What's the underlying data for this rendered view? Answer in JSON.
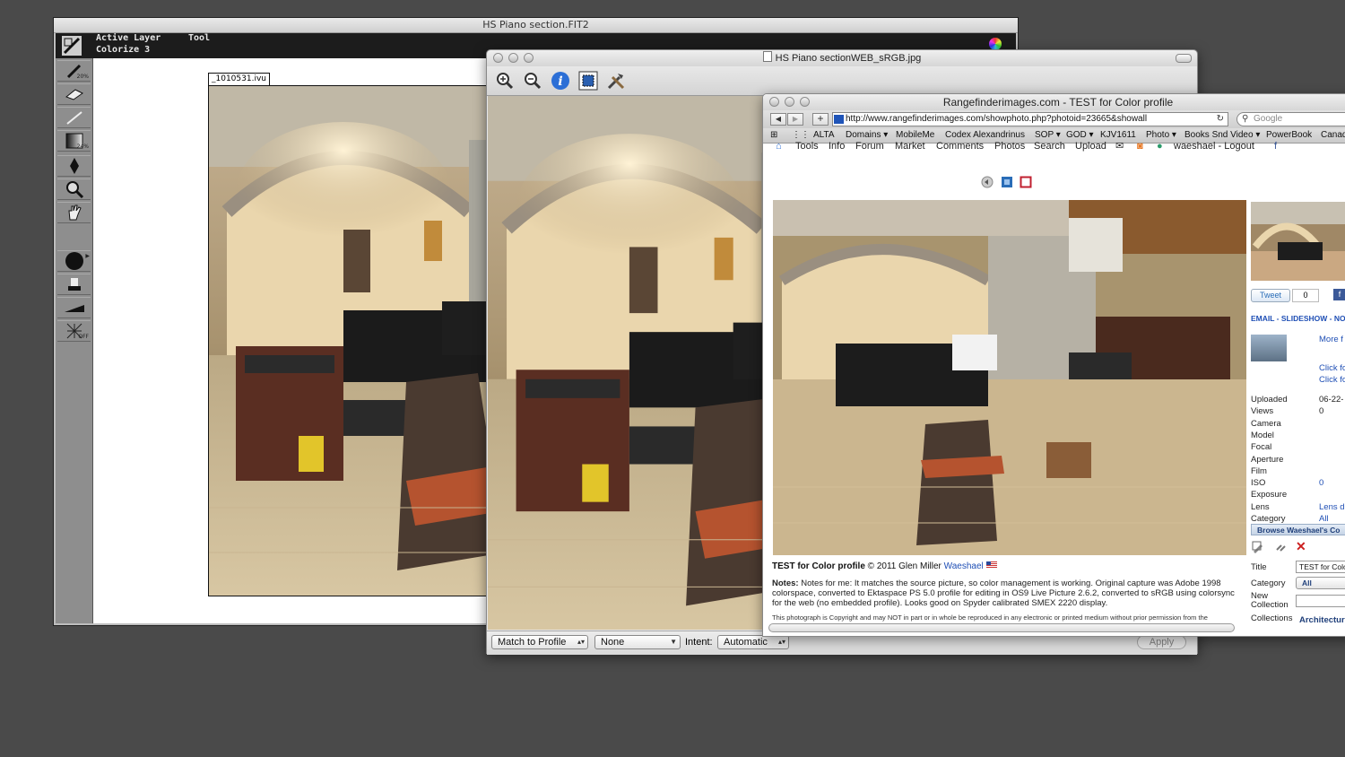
{
  "livepicture": {
    "title": "HS Piano section.FIT2",
    "active_layer_label": "Active Layer",
    "active_layer_value": "Colorize 3",
    "tool_label": "Tool",
    "doc_label": "_1010531.ivu",
    "tool_tags": {
      "brush": "20%",
      "gradient": "24%",
      "effects": "OFF"
    }
  },
  "preview": {
    "title": "HS Piano sectionWEB_sRGB.jpg",
    "match_select": "Match to Profile",
    "profile_select": "None",
    "intent_label": "Intent:",
    "intent_select": "Automatic",
    "apply_label": "Apply"
  },
  "browser": {
    "title": "Rangefinderimages.com - TEST for Color profile",
    "url": "http://www.rangefinderimages.com/showphoto.php?photoid=23665&showall",
    "search_placeholder": "Google",
    "bookmarks": [
      "ALTA",
      "Domains ▾",
      "MobileMe",
      "Codex Alexandrinus",
      "SOP ▾",
      "GOD ▾",
      "KJV1611",
      "Photo ▾",
      "Books Snd Video ▾",
      "PowerBook",
      "Canad"
    ],
    "site_nav": [
      "Tools",
      "Info",
      "Forum",
      "Market",
      "Comments",
      "Photos",
      "Search",
      "Upload",
      "waeshael - Logout"
    ],
    "photo_title": "TEST for Color profile",
    "copyright_line": "© 2011 Glen Miller",
    "author": "Waeshael",
    "notes_label": "Notes:",
    "notes_text": "Notes for me: It matches the source picture, so color management is working. Original capture was Adobe 1998 colorspace, converted to Ektaspace PS 5.0 profile for editing in OS9 Live Picture 2.6.2, converted to sRGB using colorsync for the web (no embedded profile). Looks good on Spyder calibrated SMEX 2220 display.",
    "copyright_notice": "This photograph is Copyright and may NOT in part or in whole be reproduced in any electronic or printed medium without prior permission from the",
    "tweet_label": "Tweet",
    "tweet_count": "0",
    "email_link": "EMAIL - SLIDESHOW - NOT",
    "more_link": "More f",
    "click1": "Click fo",
    "click2": "Click fo",
    "details": [
      {
        "k": "Uploaded",
        "v": "06-22-"
      },
      {
        "k": "Views",
        "v": "0"
      },
      {
        "k": "Camera",
        "v": ""
      },
      {
        "k": "Model",
        "v": ""
      },
      {
        "k": "Focal",
        "v": ""
      },
      {
        "k": "Aperture",
        "v": ""
      },
      {
        "k": "Film",
        "v": ""
      },
      {
        "k": "ISO",
        "v": "0"
      },
      {
        "k": "Exposure",
        "v": ""
      },
      {
        "k": "Lens",
        "v": "Lens d"
      },
      {
        "k": "Category",
        "v": "All"
      }
    ],
    "browse_bar": "Browse Waeshael's Co",
    "form": {
      "title_label": "Title",
      "title_value": "TEST for Colo",
      "category_label": "Category",
      "category_value": "All",
      "new_collection_label": "New Collection",
      "collections_label": "Collections",
      "collections_value": "Architecture"
    }
  }
}
